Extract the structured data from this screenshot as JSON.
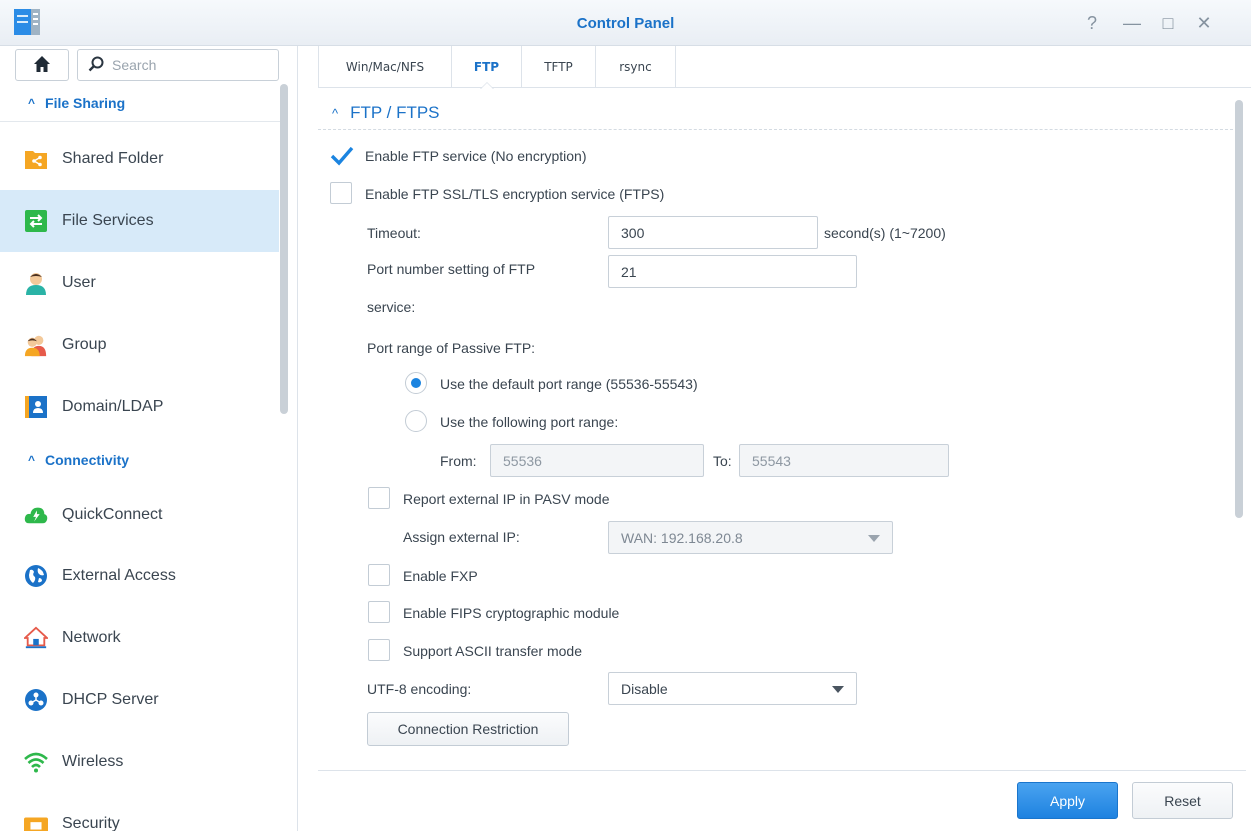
{
  "window": {
    "title": "Control Panel",
    "help_glyph": "?",
    "minimize_glyph": "—",
    "maximize_glyph": "□",
    "close_glyph": "✕"
  },
  "sidebar": {
    "search_placeholder": "Search",
    "sections": [
      {
        "label": "File Sharing",
        "items": [
          {
            "label": "Shared Folder",
            "icon": "shared-folder-icon"
          },
          {
            "label": "File Services",
            "icon": "file-services-icon",
            "active": true
          },
          {
            "label": "User",
            "icon": "user-icon"
          },
          {
            "label": "Group",
            "icon": "group-icon"
          },
          {
            "label": "Domain/LDAP",
            "icon": "domain-ldap-icon"
          }
        ]
      },
      {
        "label": "Connectivity",
        "items": [
          {
            "label": "QuickConnect",
            "icon": "quickconnect-icon"
          },
          {
            "label": "External Access",
            "icon": "external-access-icon"
          },
          {
            "label": "Network",
            "icon": "network-icon"
          },
          {
            "label": "DHCP Server",
            "icon": "dhcp-server-icon"
          },
          {
            "label": "Wireless",
            "icon": "wireless-icon"
          },
          {
            "label": "Security",
            "icon": "security-icon"
          }
        ]
      }
    ]
  },
  "tabs": [
    {
      "label": "Win/Mac/NFS"
    },
    {
      "label": "FTP",
      "active": true
    },
    {
      "label": "TFTP"
    },
    {
      "label": "rsync"
    }
  ],
  "ftp": {
    "section_title": "FTP / FTPS",
    "enable_ftp_label": "Enable FTP service (No encryption)",
    "enable_ftp_checked": true,
    "enable_ftps_label": "Enable FTP SSL/TLS encryption service (FTPS)",
    "enable_ftps_checked": false,
    "timeout_label": "Timeout:",
    "timeout_value": "300",
    "timeout_unit": "second(s) (1~7200)",
    "port_label_line1": "Port number setting of FTP",
    "port_label_line2": "service:",
    "port_value": "21",
    "passive_label": "Port range of Passive FTP:",
    "radio_default_label": "Use the default port range (55536-55543)",
    "radio_custom_label": "Use the following port range:",
    "radio_selected": "default",
    "from_label": "From:",
    "from_value": "55536",
    "to_label": "To:",
    "to_value": "55543",
    "report_ip_label": "Report external IP in PASV mode",
    "assign_ip_label": "Assign external IP:",
    "assign_ip_value": "WAN: 192.168.20.8",
    "fxp_label": "Enable FXP",
    "fips_label": "Enable FIPS cryptographic module",
    "ascii_label": "Support ASCII transfer mode",
    "utf8_label": "UTF-8 encoding:",
    "utf8_value": "Disable",
    "connection_restriction_label": "Connection Restriction"
  },
  "footer": {
    "apply_label": "Apply",
    "reset_label": "Reset"
  },
  "colors": {
    "accent": "#1b72c8",
    "active_item_bg": "#d7eaf9",
    "apply_button": "#1e82e0"
  }
}
